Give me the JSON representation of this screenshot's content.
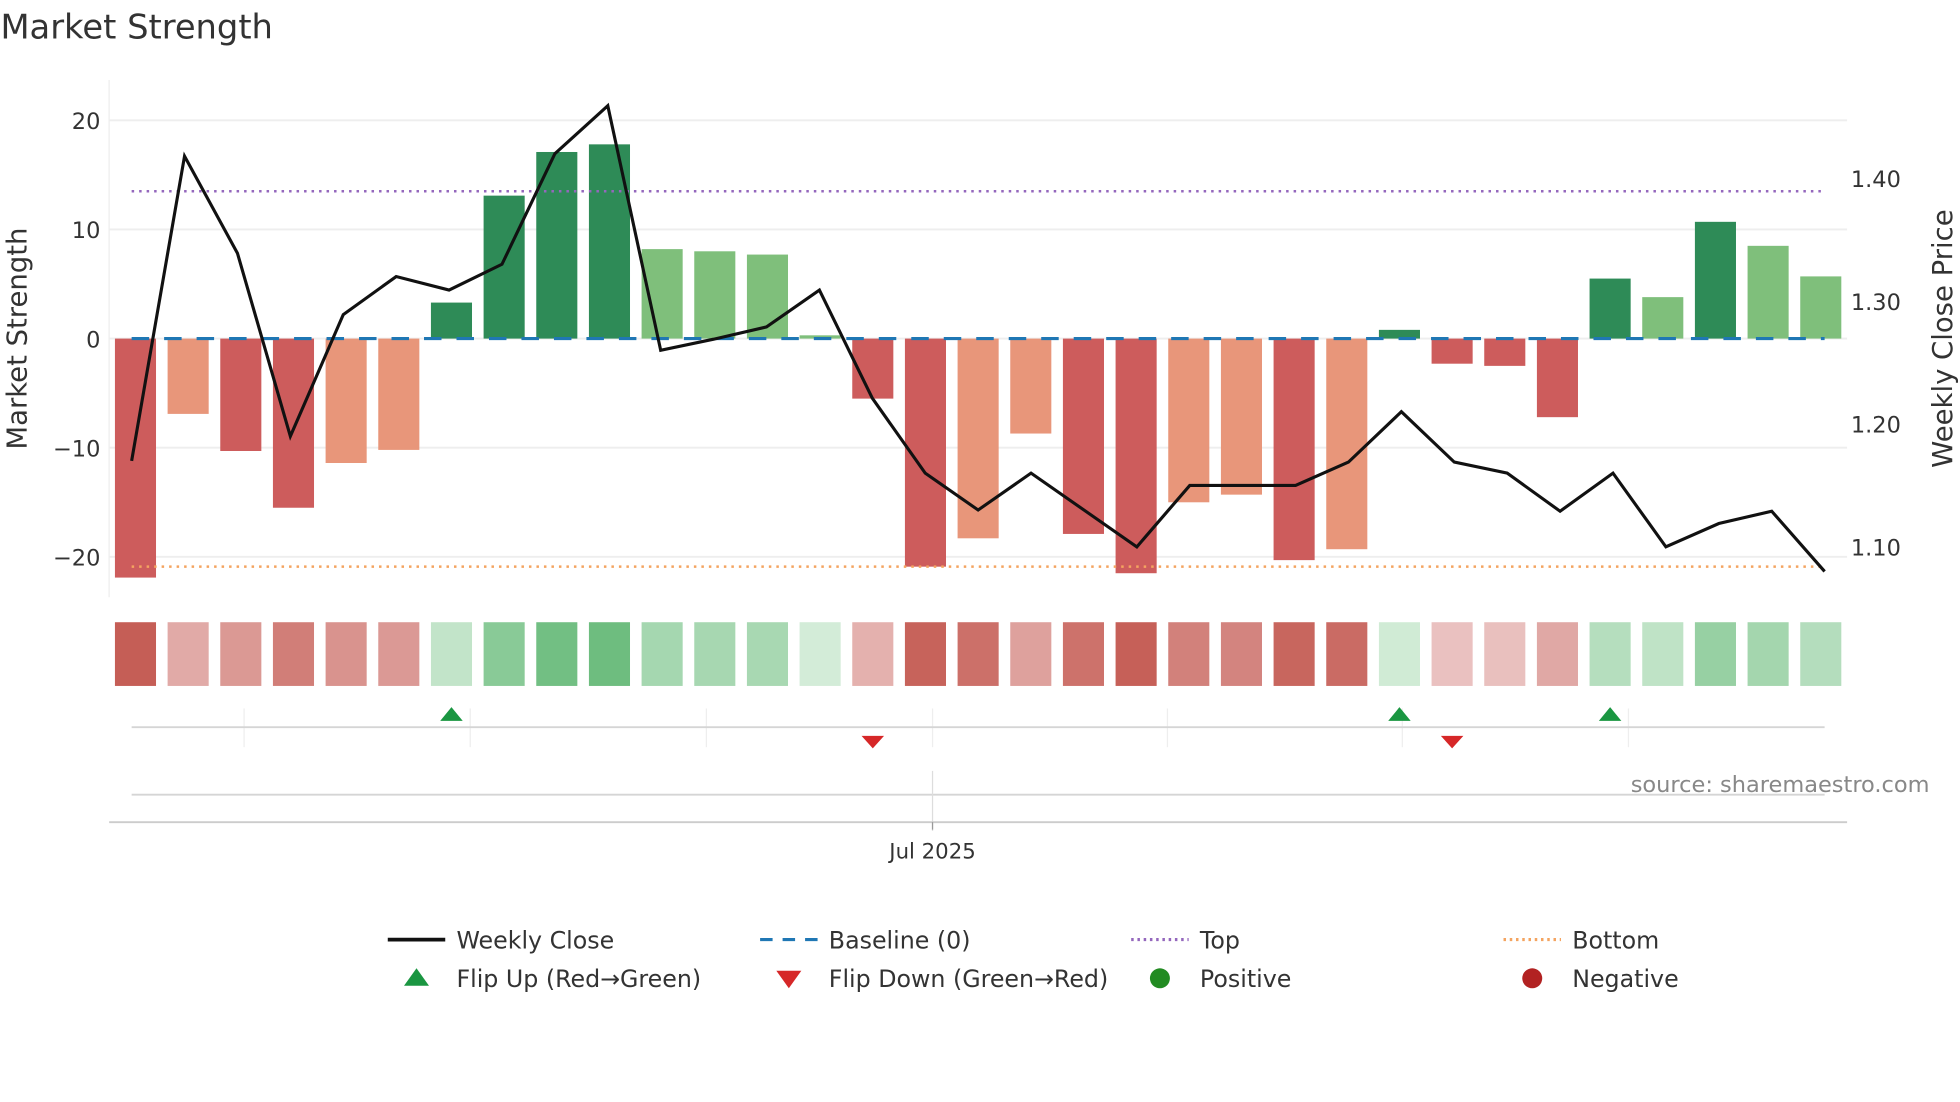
{
  "title": "Market Strength",
  "source": "source: sharemaestro.com",
  "colors": {
    "strong_neg": "#cd5c5c",
    "weak_neg": "#e8967a",
    "strong_pos": "#2e8b57",
    "weak_pos": "#7fbf7b",
    "close": "#111111",
    "baseline": "#1f77b4",
    "top": "#9467bd",
    "bottom": "#f4a460",
    "flip_up": "#1a9641",
    "flip_down": "#d62728",
    "positive": "#228b22",
    "negative": "#b22222"
  },
  "chart_data": {
    "type": "bar",
    "title": "Market Strength",
    "ylabel": "Market Strength",
    "y2label": "Weekly Close Price",
    "xlabel": "",
    "ylim": [
      -23.7,
      23.7
    ],
    "y2lim": [
      1.059,
      1.48
    ],
    "yticks": [
      "20",
      "10",
      "0",
      "−10",
      "−20"
    ],
    "ytick_values": [
      20,
      10,
      0,
      -10,
      -20
    ],
    "y2ticks": [
      "1.40",
      "1.30",
      "1.20",
      "1.10"
    ],
    "y2tick_values": [
      1.4,
      1.3,
      1.2,
      1.1
    ],
    "xticks": [
      "Jul 2025"
    ],
    "xtick_index": [
      15.3
    ],
    "baseline": 0,
    "top_threshold": 13.5,
    "bottom_threshold": -20.9,
    "strength": [
      -21.9,
      -6.9,
      -10.3,
      -15.5,
      -11.4,
      -10.2,
      3.3,
      13.1,
      17.1,
      17.8,
      8.2,
      8.0,
      7.7,
      0.3,
      -5.5,
      -20.9,
      -18.3,
      -8.7,
      -17.9,
      -21.5,
      -15.0,
      -14.3,
      -20.3,
      -19.3,
      0.8,
      -2.3,
      -2.5,
      -7.2,
      5.5,
      3.8,
      10.7,
      8.5,
      5.7
    ],
    "shade": [
      "strong",
      "weak",
      "strong",
      "strong",
      "weak",
      "weak",
      "strong",
      "strong",
      "strong",
      "strong",
      "weak",
      "weak",
      "weak",
      "weak",
      "strong",
      "strong",
      "weak",
      "weak",
      "strong",
      "strong",
      "weak",
      "weak",
      "strong",
      "weak",
      "strong",
      "strong",
      "strong",
      "strong",
      "strong",
      "weak",
      "strong",
      "weak",
      "weak"
    ],
    "weekly_close": [
      1.17,
      1.418,
      1.339,
      1.19,
      1.289,
      1.32,
      1.309,
      1.33,
      1.42,
      1.459,
      1.26,
      1.269,
      1.279,
      1.309,
      1.221,
      1.16,
      1.13,
      1.16,
      1.13,
      1.1,
      1.15,
      1.15,
      1.15,
      1.169,
      1.21,
      1.169,
      1.16,
      1.129,
      1.16,
      1.1,
      1.119,
      1.129,
      1.08
    ],
    "flip_up": [
      6,
      24,
      28
    ],
    "flip_down": [
      14,
      25
    ],
    "legend": {
      "placement": "bottom",
      "items": [
        {
          "label": "Weekly Close",
          "kind": "line-solid",
          "color": "#111111"
        },
        {
          "label": "Baseline (0)",
          "kind": "line-dash",
          "color": "#1f77b4"
        },
        {
          "label": "Top",
          "kind": "line-dot",
          "color": "#9467bd"
        },
        {
          "label": "Bottom",
          "kind": "line-dot",
          "color": "#f4a460"
        },
        {
          "label": "Flip Up (Red→Green)",
          "kind": "tri-up",
          "color": "#1a9641"
        },
        {
          "label": "Flip Down (Green→Red)",
          "kind": "tri-down",
          "color": "#d62728"
        },
        {
          "label": "Positive",
          "kind": "dot",
          "color": "#228b22"
        },
        {
          "label": "Negative",
          "kind": "dot",
          "color": "#b22222"
        }
      ]
    }
  }
}
